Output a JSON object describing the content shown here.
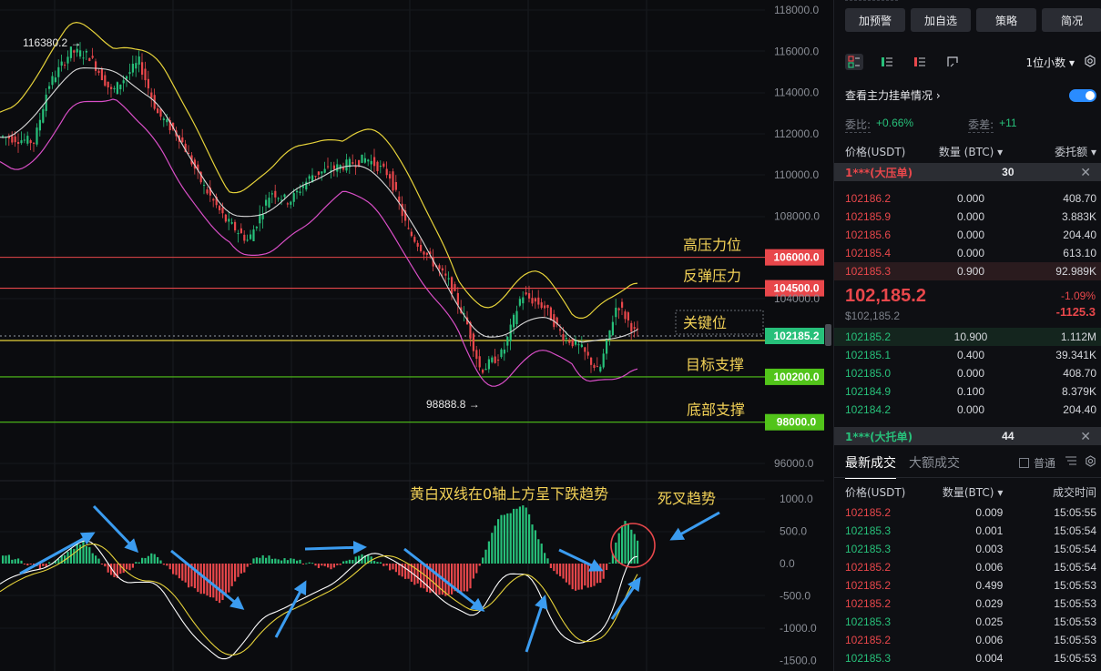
{
  "colors": {
    "up": "#27c07a",
    "down": "#e8474b",
    "bb_upper": "#e6d23a",
    "bb_mid": "#d8d8d8",
    "bb_lower": "#d84ec6",
    "annotation": "#f3d257",
    "arrow": "#3b9cf0",
    "panel_bg": "#0e0f13"
  },
  "chart": {
    "y_axis": [
      "118000.0",
      "116000.0",
      "114000.0",
      "112000.0",
      "110000.0",
      "108000.0",
      "104000.0",
      "96000.0"
    ],
    "macd_axis": [
      "1000.0",
      "500.0",
      "0.0",
      "-500.0",
      "-1000.0",
      "-1500.0"
    ],
    "high_marker": "116380.2",
    "low_marker": "98888.8",
    "levels": [
      {
        "label": "高压力位",
        "price": "106000.0",
        "color": "#e8474b"
      },
      {
        "label": "反弹压力",
        "price": "104500.0",
        "color": "#e8474b"
      },
      {
        "label": "关键位",
        "price": "102185.2",
        "color": "#27c07a"
      },
      {
        "label": "目标支撑",
        "price": "100200.0",
        "color": "#52c41a"
      },
      {
        "label": "底部支撑",
        "price": "98000.0",
        "color": "#52c41a"
      }
    ],
    "macd_note": "黄白双线在0轴上方呈下跌趋势",
    "death_cross_note": "死叉趋势"
  },
  "panel": {
    "buttons": [
      "加预警",
      "加自选",
      "策略",
      "简况"
    ],
    "decimal_select": "1位小数",
    "main_force_link": "查看主力挂单情况",
    "ratio_label": "委比:",
    "ratio_value": "+0.66%",
    "diff_label": "委差:",
    "diff_value": "+11",
    "book_headers": [
      "价格(USDT)",
      "数量 (BTC)",
      "委托额"
    ],
    "big_sell": {
      "name": "1***(大压单)",
      "count": "30"
    },
    "asks": [
      {
        "price": "102186.2",
        "qty": "0.000",
        "amt": "408.70"
      },
      {
        "price": "102185.9",
        "qty": "0.000",
        "amt": "3.883K"
      },
      {
        "price": "102185.6",
        "qty": "0.000",
        "amt": "204.40"
      },
      {
        "price": "102185.4",
        "qty": "0.000",
        "amt": "613.10"
      },
      {
        "price": "102185.3",
        "qty": "0.900",
        "amt": "92.989K"
      }
    ],
    "last_price": "102,185.2",
    "last_price_usd": "$102,185.2",
    "change_pct": "-1.09%",
    "change_abs": "-1125.3",
    "bids": [
      {
        "price": "102185.2",
        "qty": "10.900",
        "amt": "1.112M"
      },
      {
        "price": "102185.1",
        "qty": "0.400",
        "amt": "39.341K"
      },
      {
        "price": "102185.0",
        "qty": "0.000",
        "amt": "408.70"
      },
      {
        "price": "102184.9",
        "qty": "0.100",
        "amt": "8.379K"
      },
      {
        "price": "102184.2",
        "qty": "0.000",
        "amt": "204.40"
      }
    ],
    "big_buy": {
      "name": "1***(大托单)",
      "count": "44"
    },
    "trade_tabs": [
      "最新成交",
      "大额成交"
    ],
    "normal_checkbox": "普通",
    "trade_headers": [
      "价格(USDT)",
      "数量(BTC)",
      "成交时间"
    ],
    "trades": [
      {
        "price": "102185.2",
        "qty": "0.009",
        "time": "15:05:55",
        "side": "sell"
      },
      {
        "price": "102185.3",
        "qty": "0.001",
        "time": "15:05:54",
        "side": "buy"
      },
      {
        "price": "102185.3",
        "qty": "0.003",
        "time": "15:05:54",
        "side": "buy"
      },
      {
        "price": "102185.2",
        "qty": "0.006",
        "time": "15:05:54",
        "side": "sell"
      },
      {
        "price": "102185.2",
        "qty": "0.499",
        "time": "15:05:53",
        "side": "sell"
      },
      {
        "price": "102185.2",
        "qty": "0.029",
        "time": "15:05:53",
        "side": "sell"
      },
      {
        "price": "102185.3",
        "qty": "0.025",
        "time": "15:05:53",
        "side": "buy"
      },
      {
        "price": "102185.2",
        "qty": "0.006",
        "time": "15:05:53",
        "side": "sell"
      },
      {
        "price": "102185.3",
        "qty": "0.004",
        "time": "15:05:53",
        "side": "buy"
      }
    ]
  }
}
